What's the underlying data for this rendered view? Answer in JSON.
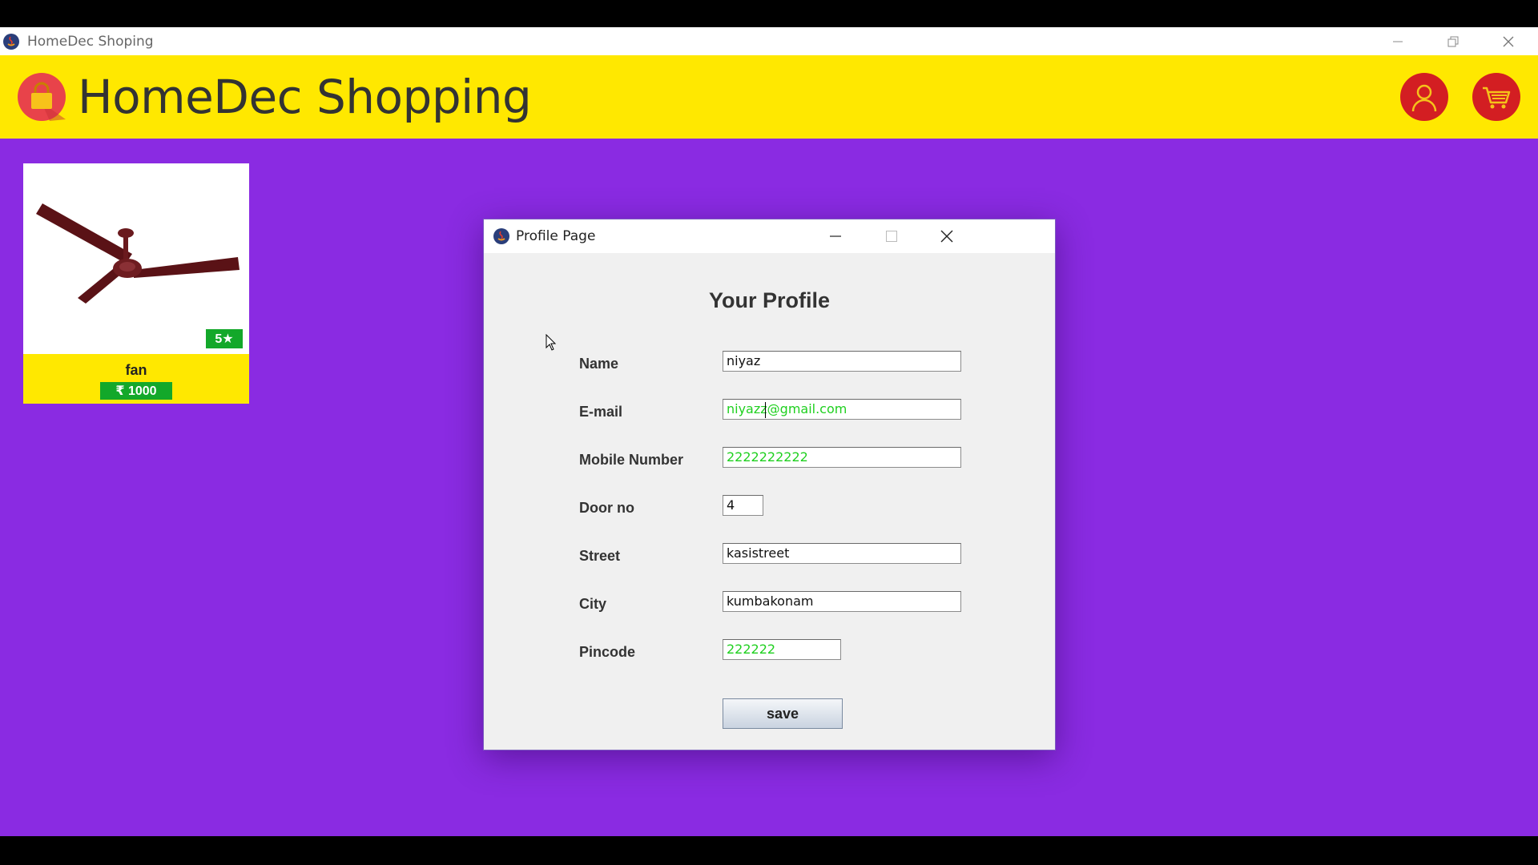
{
  "window": {
    "title": "HomeDec Shoping"
  },
  "header": {
    "brand": "HomeDec Shopping"
  },
  "products": [
    {
      "name": "fan",
      "rating": "5★",
      "price": "₹ 1000"
    }
  ],
  "dialog": {
    "title": "Profile Page",
    "heading": "Your Profile",
    "fields": [
      {
        "label": "Name",
        "value": "niyaz"
      },
      {
        "label": "E-mail",
        "value": "niyazz@gmail.com"
      },
      {
        "label": "Mobile Number",
        "value": "2222222222"
      },
      {
        "label": "Door no",
        "value": "4"
      },
      {
        "label": "Street",
        "value": "kasistreet"
      },
      {
        "label": "City",
        "value": "kumbakonam"
      },
      {
        "label": "Pincode",
        "value": "222222"
      }
    ],
    "save_label": "save"
  },
  "colors": {
    "background": "#8a2be2",
    "header": "#ffe800",
    "accent_red": "#d31e22",
    "valid_text": "#1fd01f",
    "badge_green": "#13a82a"
  },
  "icons": [
    "shopping-bag-icon",
    "user-icon",
    "cart-icon",
    "minimize-icon",
    "maximize-icon",
    "close-icon",
    "java-app-icon",
    "mouse-cursor-icon"
  ]
}
